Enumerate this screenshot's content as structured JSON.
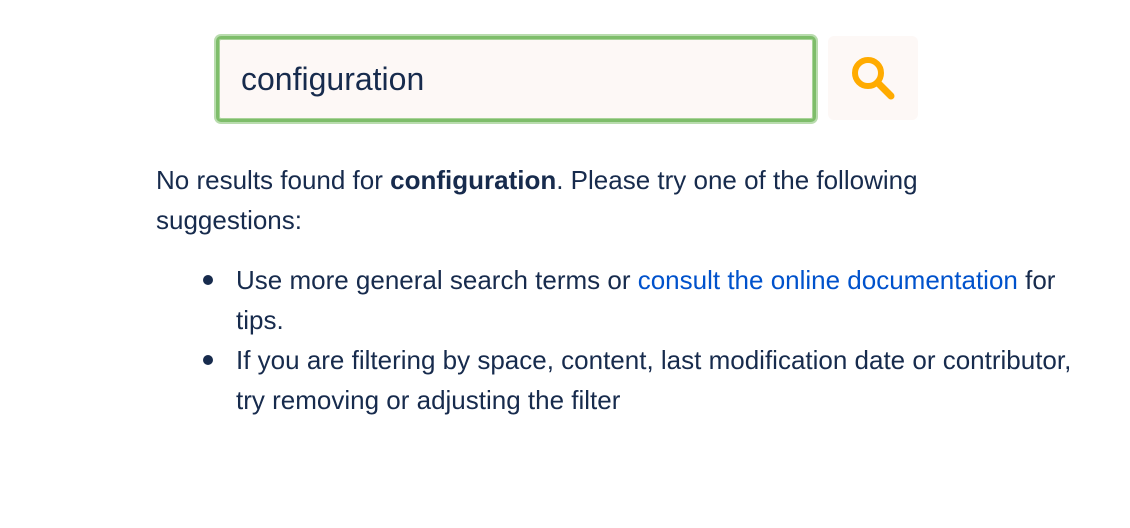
{
  "search": {
    "query": "configuration",
    "button_icon": "search-icon",
    "icon_color": "#ffab00"
  },
  "message": {
    "prefix": "No results found for ",
    "term": "configuration",
    "suffix": ". Please try one of the following suggestions:"
  },
  "suggestions": {
    "items": [
      {
        "before": "Use more general search terms or ",
        "link": "consult the online documentation",
        "after": " for tips."
      },
      {
        "text": "If you are filtering by space, content, last modification date or contributor, try removing or adjusting the filter"
      }
    ]
  },
  "colors": {
    "text": "#172b4d",
    "link": "#0052cc",
    "focus_border": "#7ebd6a",
    "input_bg": "#fdf8f6"
  }
}
